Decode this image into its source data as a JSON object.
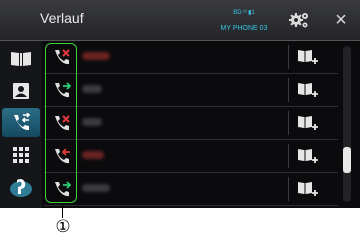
{
  "header": {
    "title": "Verlauf",
    "status_icons": "BD ⁿᴵ ▮1",
    "phone_name": "MY PHONE 03",
    "settings_icon": "settings-gear-icon",
    "close_glyph": "×"
  },
  "sidebar": {
    "items": [
      {
        "icon": "phonebook-icon",
        "active": false
      },
      {
        "icon": "contact-card-icon",
        "active": false
      },
      {
        "icon": "call-history-icon",
        "active": true
      },
      {
        "icon": "keypad-icon",
        "active": false
      },
      {
        "icon": "voice-recognition-icon",
        "active": false
      }
    ]
  },
  "call_history": {
    "rows": [
      {
        "call_type": "missed",
        "icon": "missed-call-icon",
        "name_color": "#6a2323",
        "name_width": 28
      },
      {
        "call_type": "outgoing",
        "icon": "outgoing-call-icon",
        "name_color": "#3c3c40",
        "name_width": 20
      },
      {
        "call_type": "missed",
        "icon": "missed-call-icon",
        "name_color": "#3c3c40",
        "name_width": 20
      },
      {
        "call_type": "incoming",
        "icon": "incoming-call-icon",
        "name_color": "#6a2323",
        "name_width": 22
      },
      {
        "call_type": "outgoing",
        "icon": "outgoing-call-icon",
        "name_color": "#3c3c40",
        "name_width": 28
      }
    ],
    "row_action_icon": "add-to-contacts-icon"
  },
  "scrollbar": {
    "position_fraction": 0.78
  },
  "callout": {
    "label": "①"
  },
  "colors": {
    "accent": "#38c6e8",
    "missed": "#e23a3a",
    "outgoing": "#2ecc71",
    "incoming": "#e23a3a",
    "highlight": "#3cd03c"
  }
}
